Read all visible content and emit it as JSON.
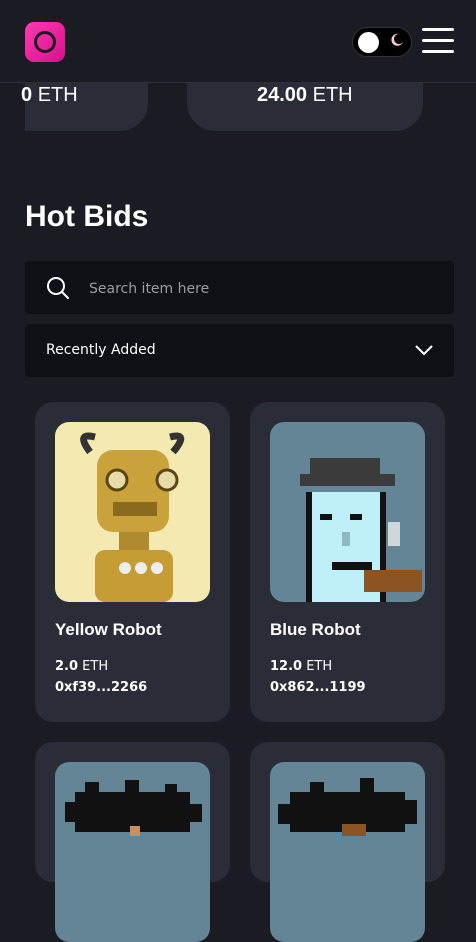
{
  "header": {
    "logo_icon": "logo-ring-icon",
    "toggle_icon": "moon-icon",
    "menu_icon": "hamburger-menu-icon",
    "brand_color": "#e8169a"
  },
  "stats": [
    {
      "value": "0",
      "unit": "ETH"
    },
    {
      "value": "24.00",
      "unit": "ETH"
    }
  ],
  "hot_bids": {
    "title": "Hot Bids",
    "search_placeholder": "Search item here",
    "sort_selected": "Recently Added",
    "items": [
      {
        "title": "Yellow Robot",
        "price": "2.0",
        "unit": "ETH",
        "owner": "0xf39...2266"
      },
      {
        "title": "Blue Robot",
        "price": "12.0",
        "unit": "ETH",
        "owner": "0x862...1199"
      }
    ]
  }
}
